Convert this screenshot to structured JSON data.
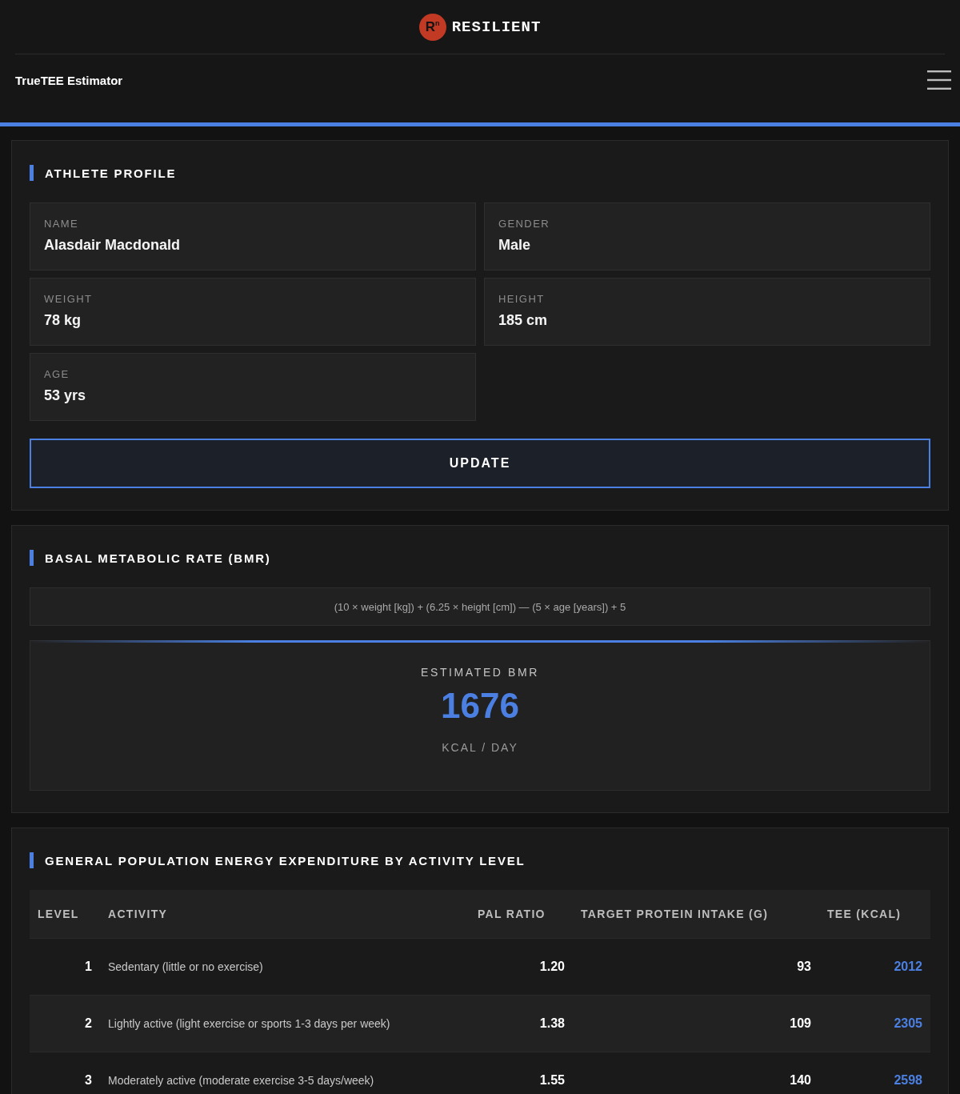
{
  "header": {
    "logo_mark": "R$^{n}$",
    "brand": "RESILIENT",
    "title": "TrueTEE Estimator"
  },
  "profile": {
    "heading": "ATHLETE PROFILE",
    "fields": [
      {
        "label": "NAME",
        "value": "Alasdair Macdonald"
      },
      {
        "label": "GENDER",
        "value": "Male"
      },
      {
        "label": "WEIGHT",
        "value": "78 kg"
      },
      {
        "label": "HEIGHT",
        "value": "185 cm"
      },
      {
        "label": "AGE",
        "value": "53 yrs"
      }
    ],
    "button": "UPDATE"
  },
  "bmr": {
    "heading": "BASAL METABOLIC RATE (BMR)",
    "formula": "(10 × weight [kg]) + (6.25 × height [cm]) — (5 × age [years]) + 5",
    "result_label": "ESTIMATED BMR",
    "result_value": "1676",
    "result_unit": "KCAL / DAY"
  },
  "activity": {
    "heading": "GENERAL POPULATION ENERGY EXPENDITURE BY ACTIVITY LEVEL",
    "columns": [
      "LEVEL",
      "ACTIVITY",
      "PAL RATIO",
      "TARGET PROTEIN INTAKE (G)",
      "TEE (KCAL)"
    ],
    "rows": [
      {
        "level": "1",
        "activity": "Sedentary (little or no exercise)",
        "pal_ratio": "1.20",
        "protein": "93",
        "tee": "2012"
      },
      {
        "level": "2",
        "activity": "Lightly active (light exercise or sports 1-3 days per week)",
        "pal_ratio": "1.38",
        "protein": "109",
        "tee": "2305"
      },
      {
        "level": "3",
        "activity": "Moderately active (moderate exercise 3-5 days/week)",
        "pal_ratio": "1.55",
        "protein": "140",
        "tee": "2598"
      }
    ]
  }
}
